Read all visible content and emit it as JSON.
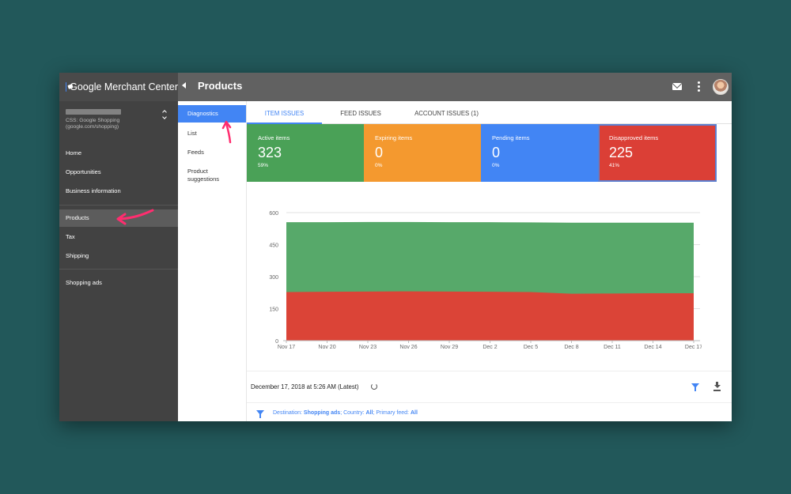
{
  "app": {
    "brand": "Google Merchant Center",
    "page_title": "Products"
  },
  "account": {
    "sub_line1": "CSS: Google Shopping",
    "sub_line2": "(google.com/shopping)"
  },
  "leftnav": {
    "items": [
      {
        "label": "Home"
      },
      {
        "label": "Opportunities"
      },
      {
        "label": "Business information"
      },
      {
        "label": "Products"
      },
      {
        "label": "Tax"
      },
      {
        "label": "Shipping"
      },
      {
        "label": "Shopping ads"
      }
    ],
    "active": "Products"
  },
  "subnav": {
    "items": [
      {
        "label": "Diagnostics"
      },
      {
        "label": "List"
      },
      {
        "label": "Feeds"
      },
      {
        "label": "Product suggestions"
      }
    ],
    "active": "Diagnostics"
  },
  "tabs": [
    {
      "label": "ITEM ISSUES"
    },
    {
      "label": "FEED ISSUES"
    },
    {
      "label": "ACCOUNT ISSUES (1)"
    }
  ],
  "cards": [
    {
      "label": "Active items",
      "value": "323",
      "pct": "59%",
      "color": "#4aa157"
    },
    {
      "label": "Expiring items",
      "value": "0",
      "pct": "0%",
      "color": "#f4992f"
    },
    {
      "label": "Pending items",
      "value": "0",
      "pct": "0%",
      "color": "#4285f4"
    },
    {
      "label": "Disapproved items",
      "value": "225",
      "pct": "41%",
      "color": "#db3f36"
    }
  ],
  "chart_data": {
    "type": "area",
    "x": [
      "Nov 17",
      "Nov 20",
      "Nov 23",
      "Nov 26",
      "Nov 29",
      "Dec 2",
      "Dec 5",
      "Dec 8",
      "Dec 11",
      "Dec 14",
      "Dec 17"
    ],
    "ylim": [
      0,
      600
    ],
    "yticks": [
      0,
      150,
      300,
      450,
      600
    ],
    "stacked": true,
    "grid": true,
    "series": [
      {
        "color": "#db4437",
        "values": [
          228,
          229,
          230,
          231,
          230,
          229,
          228,
          220,
          221,
          222,
          222
        ]
      },
      {
        "color": "#57a96a",
        "values": [
          555,
          555,
          556,
          556,
          555,
          555,
          554,
          553,
          553,
          553,
          553
        ]
      }
    ]
  },
  "footer": {
    "date": "December 17, 2018 at 5:26 AM (Latest)",
    "filter_prefix": "Destination:",
    "filter_dest": "Shopping ads",
    "filter_country_label": "; Country:",
    "filter_country": "All",
    "filter_feed_label": "; Primary feed:",
    "filter_feed": "All"
  },
  "colors": {
    "accent": "#4285f4",
    "annotation": "#ff2d6f"
  }
}
